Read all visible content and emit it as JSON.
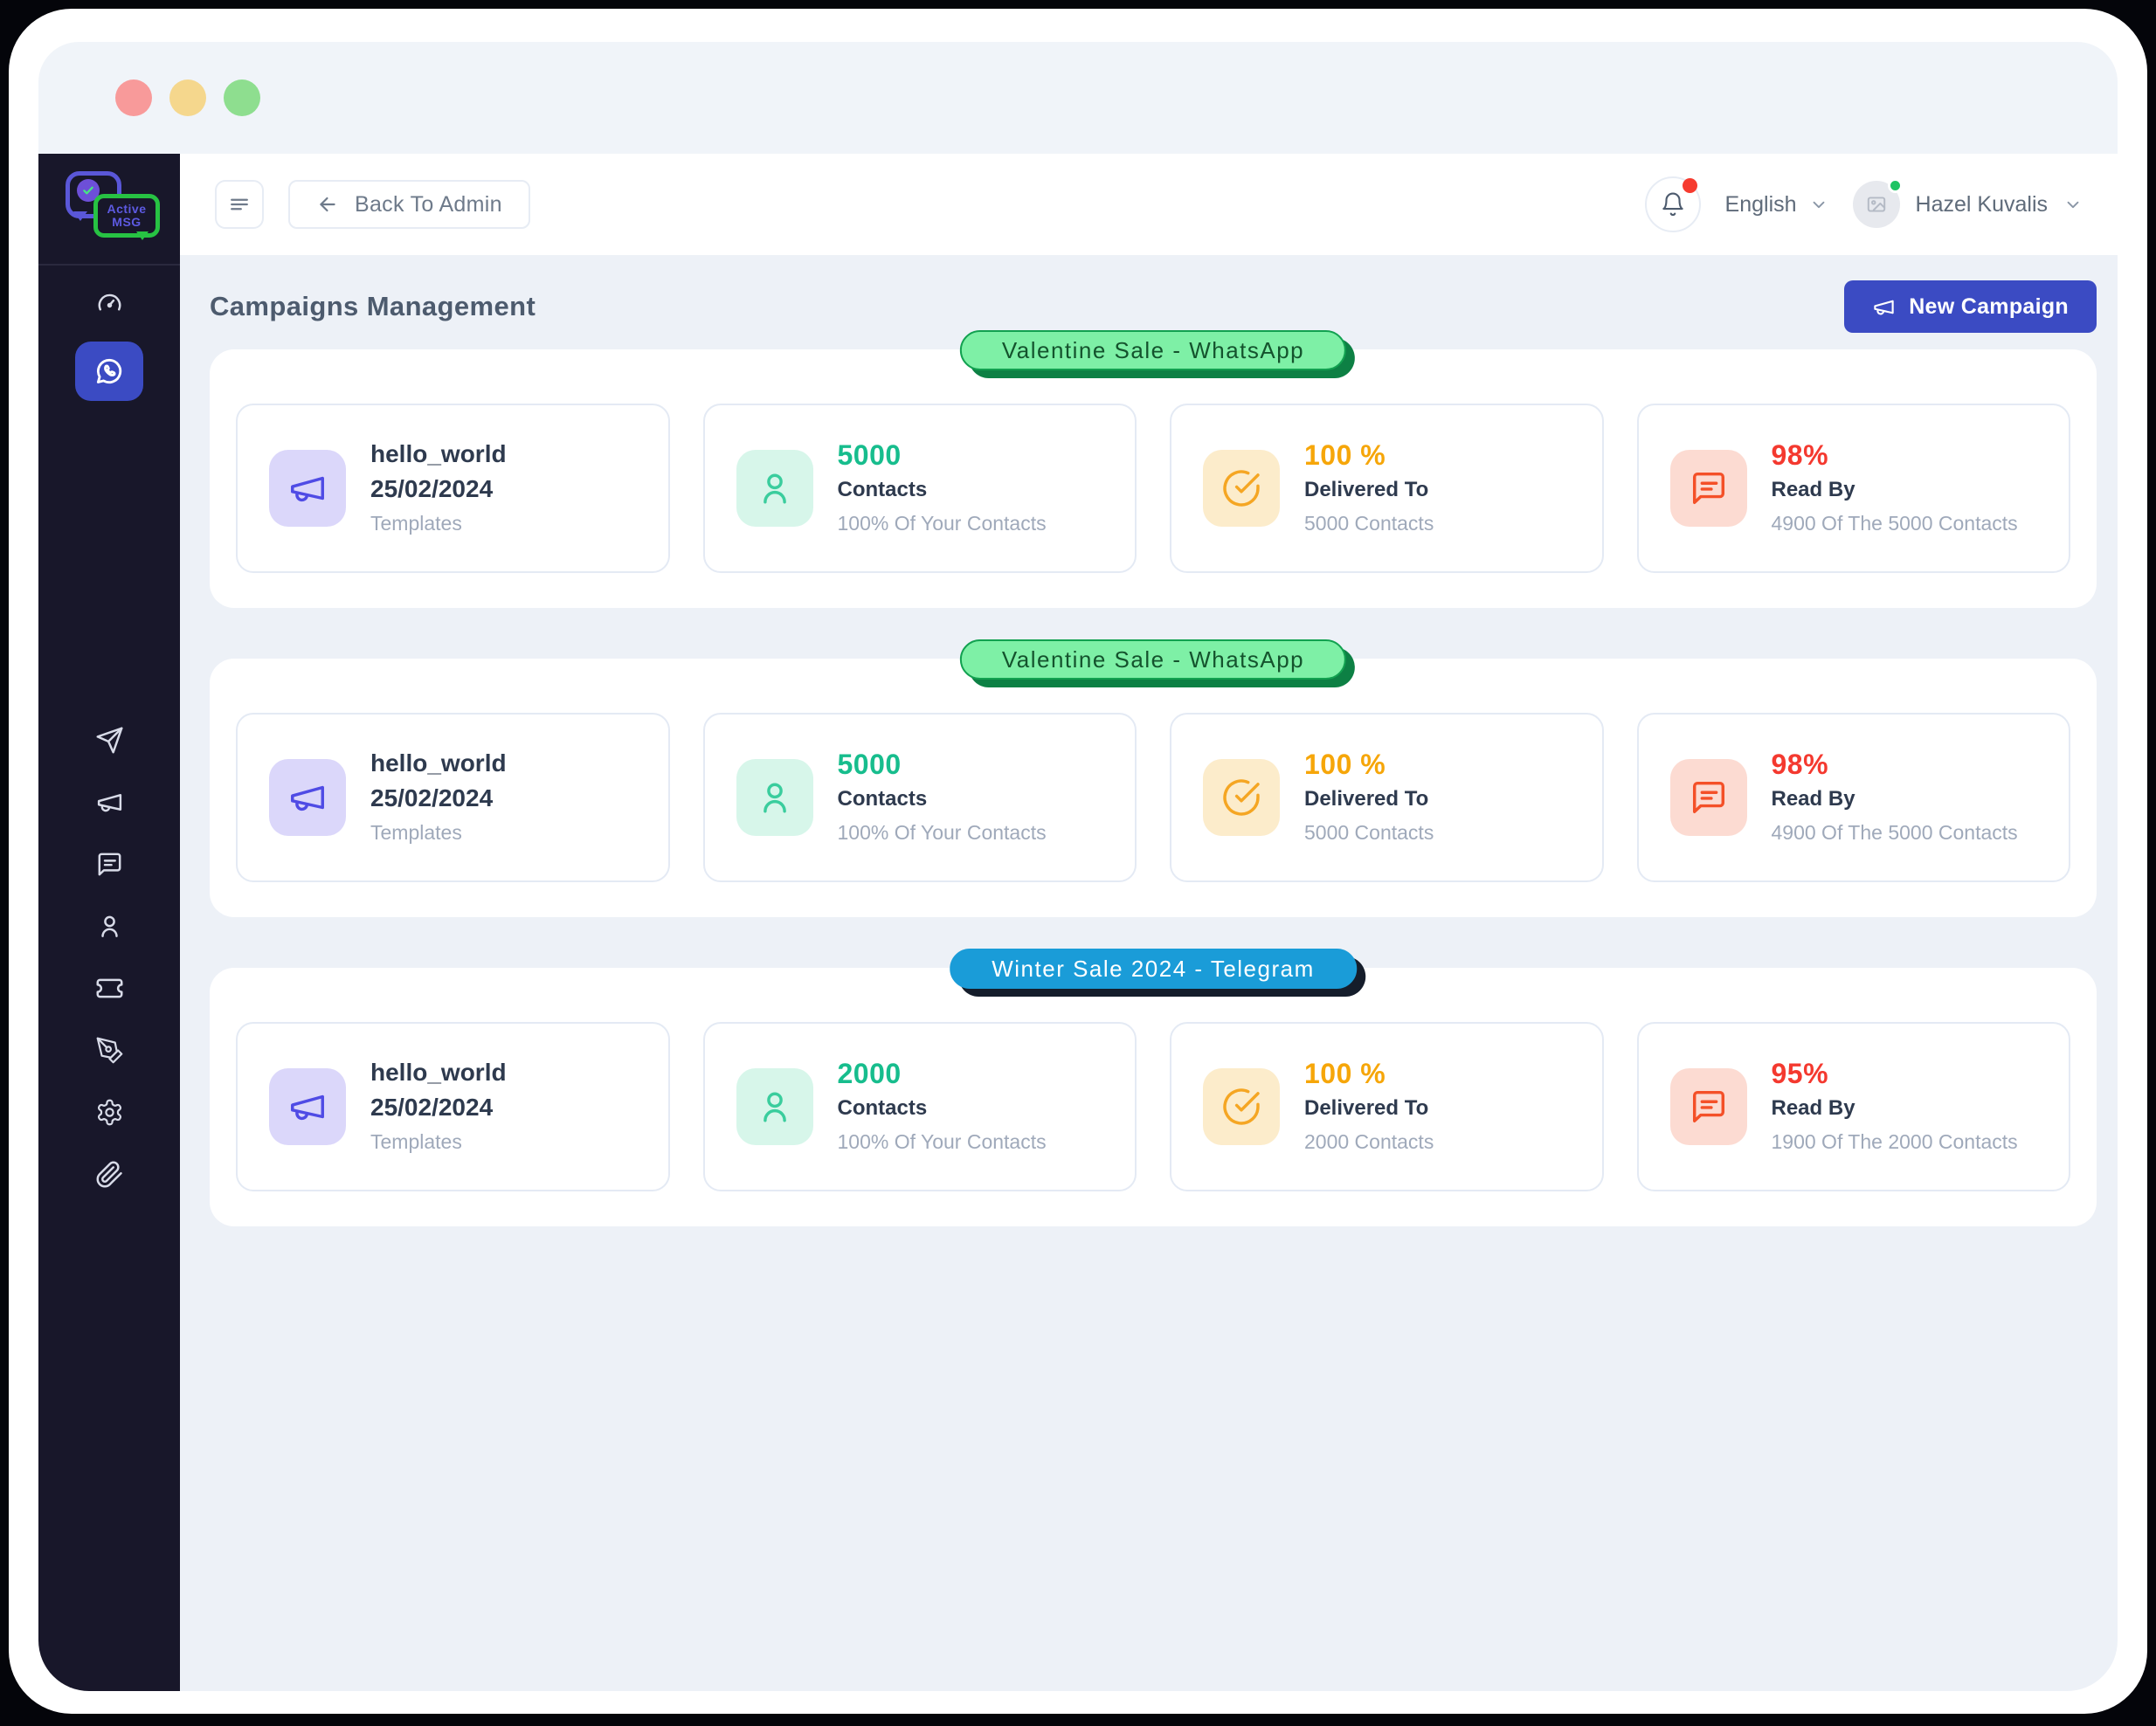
{
  "window": {
    "traffic_lights": {
      "close": "#f89a9a",
      "minimize": "#f5d78d",
      "maximize": "#8ede8f"
    }
  },
  "sidebar": {
    "logo": {
      "line1": "Active",
      "line2": "MSG"
    },
    "colors": {
      "background": "#18172a",
      "active_item": "#3b4bc3"
    },
    "top_items": [
      {
        "icon": "gauge-icon",
        "active": false
      },
      {
        "icon": "whatsapp-icon",
        "active": true
      }
    ],
    "bottom_items": [
      {
        "icon": "send-icon"
      },
      {
        "icon": "megaphone-icon"
      },
      {
        "icon": "chat-icon"
      },
      {
        "icon": "user-icon"
      },
      {
        "icon": "ticket-icon"
      },
      {
        "icon": "pen-icon"
      },
      {
        "icon": "gear-icon"
      },
      {
        "icon": "paperclip-icon"
      }
    ]
  },
  "topbar": {
    "back_label": "Back To Admin",
    "language": "English",
    "user_name": "Hazel Kuvalis",
    "has_notification": true,
    "user_online": true
  },
  "page": {
    "title": "Campaigns Management",
    "new_campaign_label": "New Campaign",
    "accent_color": "#3b4bc3"
  },
  "campaigns": [
    {
      "badge": {
        "label": "Valentine Sale - WhatsApp",
        "bg": "#7ef0a6",
        "border": "#12a150",
        "shadow": "#0d8044",
        "text": "#14532d"
      },
      "cards": [
        {
          "kind": "template",
          "icon": "megaphone-icon",
          "icon_color": "#4f4be5",
          "icon_bg": "#dbd7fa",
          "title": "hello_world",
          "date": "25/02/2024",
          "sub": "Templates"
        },
        {
          "kind": "stat",
          "icon": "user-icon",
          "icon_color": "#3acd9d",
          "icon_bg": "#d7f6ea",
          "value": "5000",
          "value_color": "#17bd8d",
          "label": "Contacts",
          "sub": "100% Of Your Contacts"
        },
        {
          "kind": "stat",
          "icon": "check-circle-icon",
          "icon_color": "#f5a623",
          "icon_bg": "#fceccb",
          "value": "100 %",
          "value_color": "#f6a609",
          "label": "Delivered To",
          "sub": "5000 Contacts"
        },
        {
          "kind": "stat",
          "icon": "message-icon",
          "icon_color": "#f45028",
          "icon_bg": "#fcdbd2",
          "value": "98%",
          "value_color": "#f4392f",
          "label": "Read By",
          "sub": "4900 Of The 5000 Contacts"
        }
      ]
    },
    {
      "badge": {
        "label": "Valentine Sale - WhatsApp",
        "bg": "#7ef0a6",
        "border": "#12a150",
        "shadow": "#0d8044",
        "text": "#14532d"
      },
      "cards": [
        {
          "kind": "template",
          "icon": "megaphone-icon",
          "icon_color": "#4f4be5",
          "icon_bg": "#dbd7fa",
          "title": "hello_world",
          "date": "25/02/2024",
          "sub": "Templates"
        },
        {
          "kind": "stat",
          "icon": "user-icon",
          "icon_color": "#3acd9d",
          "icon_bg": "#d7f6ea",
          "value": "5000",
          "value_color": "#17bd8d",
          "label": "Contacts",
          "sub": "100% Of Your Contacts"
        },
        {
          "kind": "stat",
          "icon": "check-circle-icon",
          "icon_color": "#f5a623",
          "icon_bg": "#fceccb",
          "value": "100 %",
          "value_color": "#f6a609",
          "label": "Delivered To",
          "sub": "5000 Contacts"
        },
        {
          "kind": "stat",
          "icon": "message-icon",
          "icon_color": "#f45028",
          "icon_bg": "#fcdbd2",
          "value": "98%",
          "value_color": "#f4392f",
          "label": "Read By",
          "sub": "4900 Of The 5000 Contacts"
        }
      ]
    },
    {
      "badge": {
        "label": "Winter Sale 2024 - Telegram",
        "bg": "#1a9cd8",
        "border": "#1a9cd8",
        "shadow": "#151d2b",
        "text": "#ffffff"
      },
      "cards": [
        {
          "kind": "template",
          "icon": "megaphone-icon",
          "icon_color": "#4f4be5",
          "icon_bg": "#dbd7fa",
          "title": "hello_world",
          "date": "25/02/2024",
          "sub": "Templates"
        },
        {
          "kind": "stat",
          "icon": "user-icon",
          "icon_color": "#3acd9d",
          "icon_bg": "#d7f6ea",
          "value": "2000",
          "value_color": "#17bd8d",
          "label": "Contacts",
          "sub": "100% Of Your Contacts"
        },
        {
          "kind": "stat",
          "icon": "check-circle-icon",
          "icon_color": "#f5a623",
          "icon_bg": "#fceccb",
          "value": "100 %",
          "value_color": "#f6a609",
          "label": "Delivered To",
          "sub": "2000 Contacts"
        },
        {
          "kind": "stat",
          "icon": "message-icon",
          "icon_color": "#f45028",
          "icon_bg": "#fcdbd2",
          "value": "95%",
          "value_color": "#f4392f",
          "label": "Read By",
          "sub": "1900 Of The 2000 Contacts"
        }
      ]
    }
  ]
}
